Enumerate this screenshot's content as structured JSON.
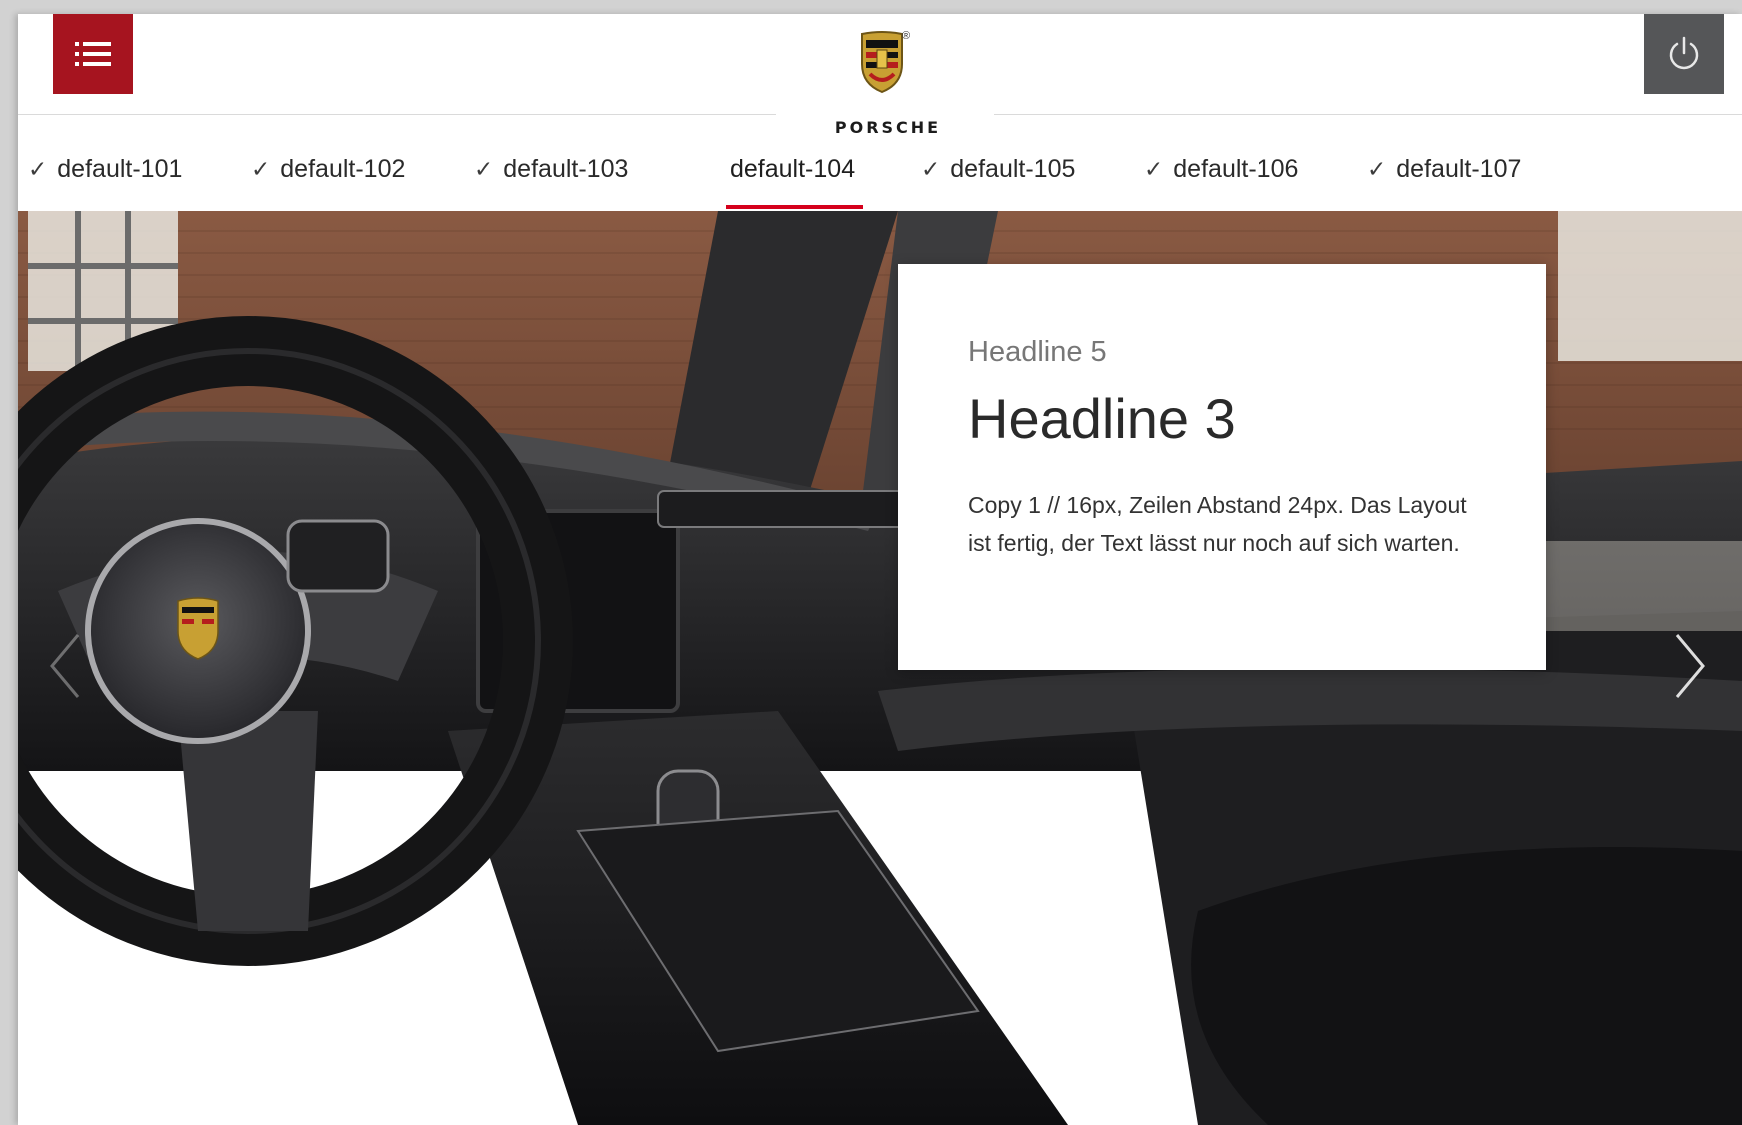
{
  "header": {
    "brand": "PORSCHE",
    "trademark": "®",
    "menu_icon": "list-menu-icon",
    "power_icon": "power-icon",
    "accent_color": "#a6141f",
    "power_bg_color": "#555658"
  },
  "tabs": [
    {
      "label": "default-101",
      "checked": true,
      "active": false
    },
    {
      "label": "default-102",
      "checked": true,
      "active": false
    },
    {
      "label": "default-103",
      "checked": true,
      "active": false
    },
    {
      "label": "default-104",
      "checked": false,
      "active": true
    },
    {
      "label": "default-105",
      "checked": true,
      "active": false
    },
    {
      "label": "default-106",
      "checked": true,
      "active": false
    },
    {
      "label": "default-107",
      "checked": true,
      "active": false
    }
  ],
  "check_glyph": "✓",
  "tab_underline_color": "#d5001c",
  "card": {
    "eyebrow": "Headline 5",
    "headline": "Headline 3",
    "copy": "Copy 1 // 16px, Zeilen Abstand 24px. Das Layout ist fertig, der Text lässt nur noch auf sich warten."
  },
  "carousel": {
    "prev_icon": "chevron-left-icon",
    "next_icon": "chevron-right-icon"
  }
}
